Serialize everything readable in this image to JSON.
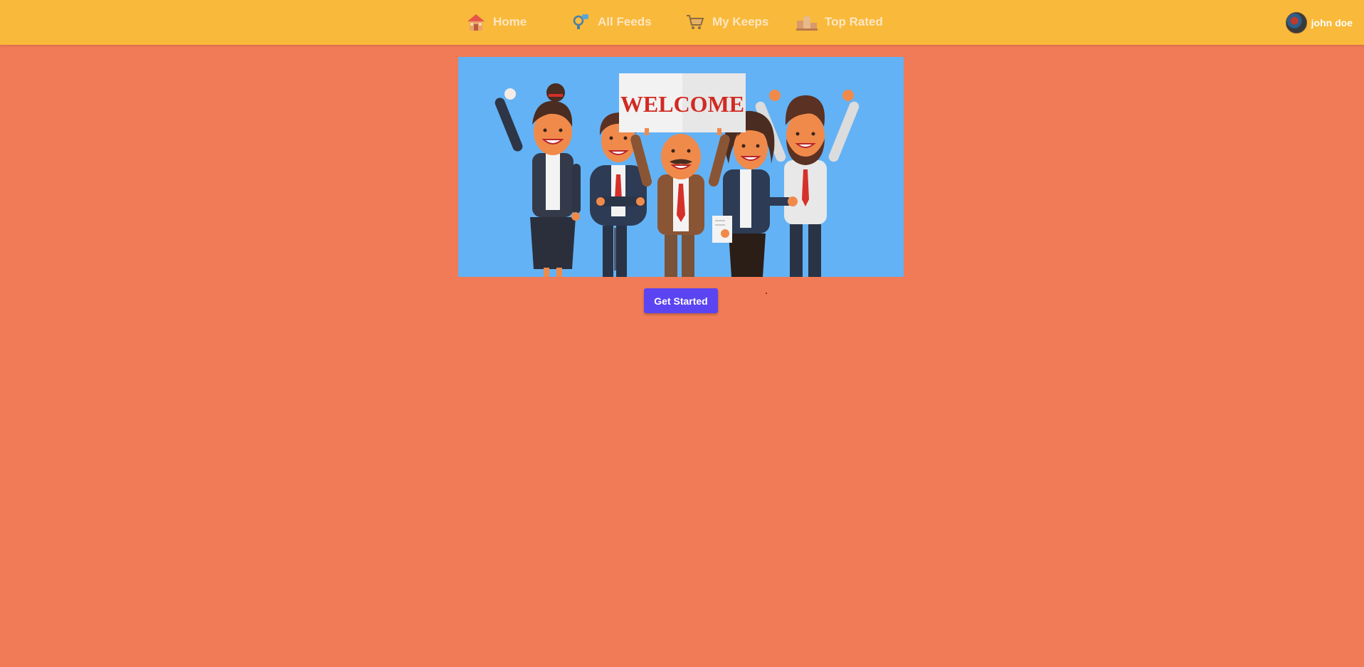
{
  "nav": {
    "items": [
      {
        "label": "Home",
        "icon": "house-icon"
      },
      {
        "label": "All Feeds",
        "icon": "feeds-icon"
      },
      {
        "label": "My Keeps",
        "icon": "cart-icon"
      },
      {
        "label": "Top Rated",
        "icon": "podium-icon"
      }
    ],
    "user": {
      "name": "john doe",
      "icon": "avatar"
    }
  },
  "hero": {
    "sign_text": "WELCOME"
  },
  "cta": {
    "label": "Get Started"
  },
  "colors": {
    "navbar": "#f9b93a",
    "background": "#f07b56",
    "hero_bg": "#63b2f5",
    "button": "#5b44f2",
    "nav_text": "#fde6c4"
  }
}
